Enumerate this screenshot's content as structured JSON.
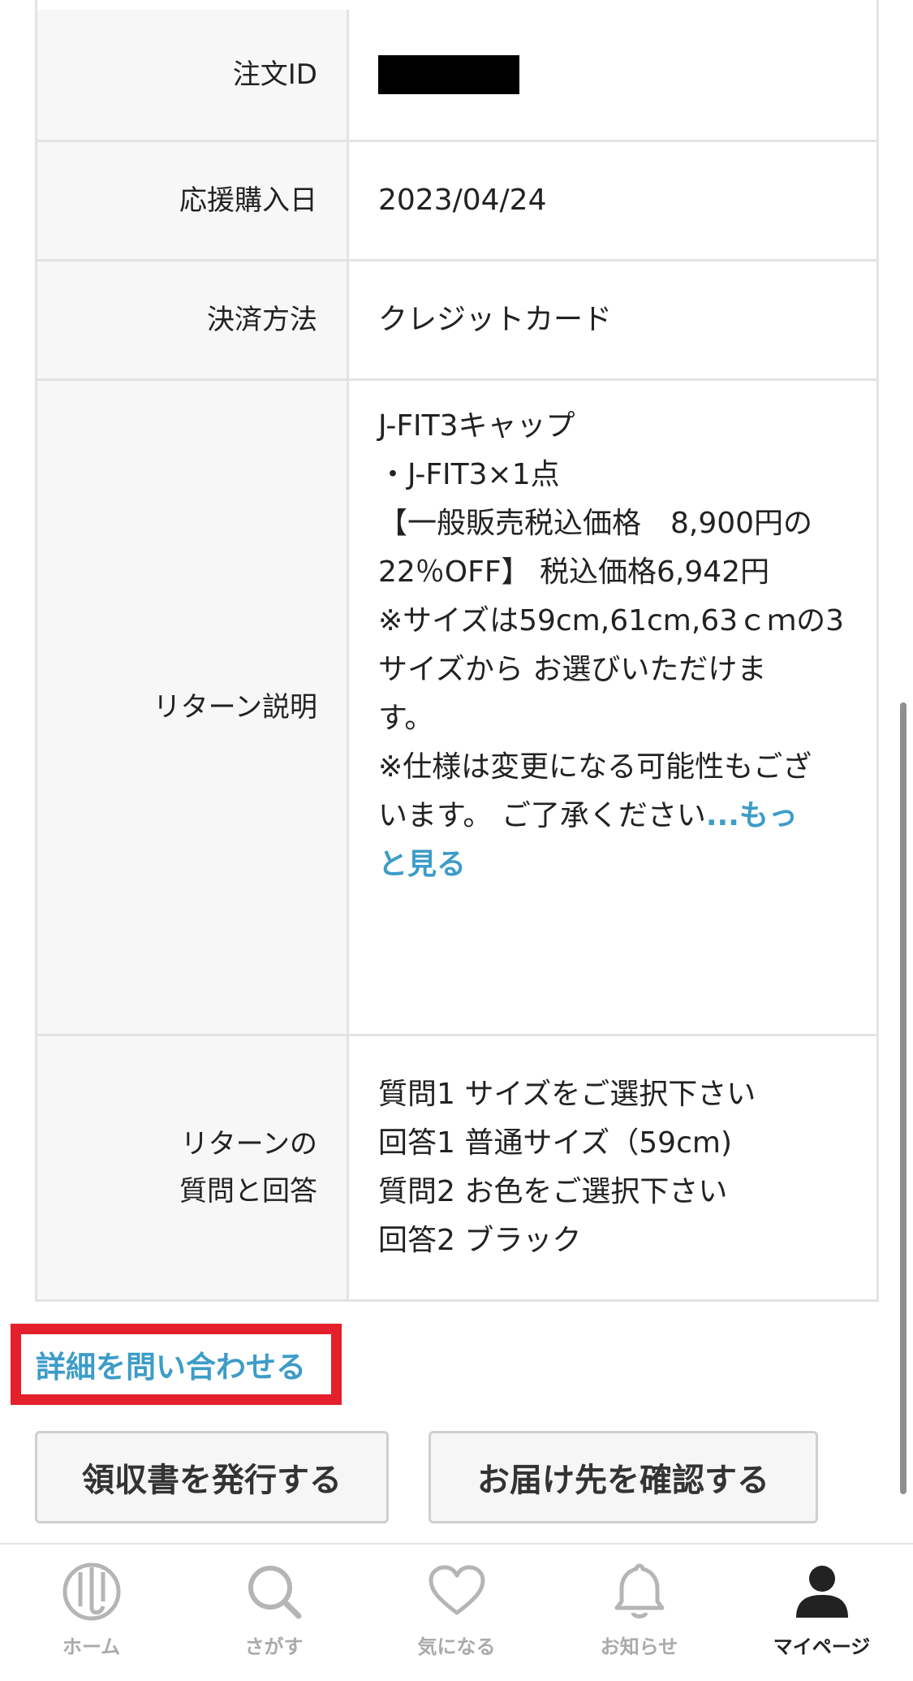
{
  "order_table": {
    "rows": [
      {
        "label": "注文ID",
        "value": ""
      },
      {
        "label": "応援購入日",
        "value": "2023/04/24"
      },
      {
        "label": "決済方法",
        "value": "クレジットカード"
      }
    ],
    "return_description": {
      "label": "リターン説明",
      "lines": [
        "J-FIT3キャップ",
        "・J-FIT3×1点",
        "",
        "【一般販売税込価格　8,900円の",
        "22％OFF】 税込価格6,942円",
        "",
        "※サイズは59cm,61cm,63ｃｍの3",
        "サイズから お選びいただけま",
        "す。",
        "※仕様は変更になる可能性もござ",
        "います。 ご了承ください"
      ],
      "more_link_part1": "...もっ",
      "more_link_part2": "と見る"
    },
    "qa": {
      "label_line1": "リターンの",
      "label_line2": "質問と回答",
      "lines": [
        "質問1 サイズをご選択下さい",
        "回答1 普通サイズ（59cm)",
        "質問2 お色をご選択下さい",
        "回答2 ブラック"
      ]
    }
  },
  "actions": {
    "inquiry_link": "詳細を問い合わせる",
    "receipt_button": "領収書を発行する",
    "address_button": "お届け先を確認する"
  },
  "tabbar": {
    "tabs": [
      {
        "label": "ホーム",
        "icon": "home-logo-icon"
      },
      {
        "label": "さがす",
        "icon": "search-icon"
      },
      {
        "label": "気になる",
        "icon": "heart-icon"
      },
      {
        "label": "お知らせ",
        "icon": "bell-icon"
      },
      {
        "label": "マイページ",
        "icon": "user-icon",
        "active": true
      }
    ]
  },
  "colors": {
    "link": "#3d9cc8",
    "highlight": "#e3202b",
    "border": "#e3e3e3",
    "header_bg": "#f7f7f7"
  }
}
